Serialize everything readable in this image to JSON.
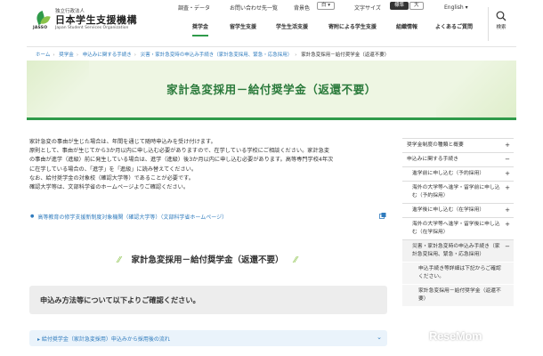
{
  "header": {
    "org_small": "独立行政法人",
    "org_name": "日本学生支援機構",
    "org_en": "Japan Student Services Organization",
    "logo_abbr": "JASSO",
    "util": {
      "survey": "調査・データ",
      "contact": "お問い合わせ先一覧",
      "bg_label": "背景色",
      "bg_value": "白",
      "text_size_label": "文字サイズ",
      "text_size_standard": "標準",
      "text_size_large": "大",
      "language": "English"
    },
    "nav": [
      "奨学金",
      "留学生支援",
      "学生生活支援",
      "寄附による学生支援",
      "組織情報",
      "よくあるご質問"
    ],
    "nav_active": 0,
    "search_label": "検索"
  },
  "breadcrumb": {
    "items": [
      "ホーム",
      "奨学金",
      "申込みに関する手続き",
      "災害・家計急変時の申込み手続き（家計急変採用、緊急・応急採用）"
    ],
    "current": "家計急変採用－給付奨学金（返還不要）"
  },
  "page_title": "家計急変採用－給付奨学金（返還不要）",
  "intro": {
    "lines": [
      "家計急変の事由が生じた場合は、年間を通じて随時申込みを受け付けます。",
      "原則として、事由が生じてから3か月以内に申し込む必要がありますので、在学している学校にご相談ください。家計急変",
      "の事由が進学（進級）前に発生している場合は、進学（進級）後3か月以内に申し込む必要があります。高等専門学校4年次",
      "に在学している場合の、「進学」を「進級」に読み替えてください。",
      "なお、給付奨学金の対象校（確認大学等）であることが必要です。",
      "確認大学等は、文部科学省のホームページよりご確認ください。"
    ]
  },
  "external_link": {
    "text": "高等教育の修学支援新制度対象機関（確認大学等）（文部科学省ホームページ）"
  },
  "section_heading": "家計急変採用－給付奨学金（返還不要）",
  "notice_text": "申込み方法等について以下よりご確認ください。",
  "accordion_label": "給付奨学金（家計急変採用）申込みから採用後の流れ",
  "sidebar": {
    "items": [
      {
        "label": "奨学金制度の種類と概要",
        "toggle": "+",
        "level": 0
      },
      {
        "label": "申込みに関する手続き",
        "toggle": "−",
        "level": 0
      },
      {
        "label": "進学前に申し込む（予約採用）",
        "toggle": "+",
        "level": 1
      },
      {
        "label": "海外の大学等へ進学・留学前に申し込む（予約採用）",
        "toggle": "+",
        "level": 1
      },
      {
        "label": "進学後に申し込む（在学採用）",
        "toggle": "+",
        "level": 1
      },
      {
        "label": "海外の大学等へ進学・留学後に申し込む（在学採用）",
        "toggle": "+",
        "level": 1
      },
      {
        "label": "災害・家計急変時の申込み手続き（家計急変採用、緊急・応急採用）",
        "toggle": "−",
        "level": 1
      },
      {
        "label": "申込手続き等詳細は下記からご確認ください。",
        "toggle": "",
        "level": 2
      },
      {
        "label": "家計急変採用－給付奨学金（返還不要）",
        "toggle": "",
        "level": 2
      }
    ]
  },
  "watermark": "ReseMom"
}
